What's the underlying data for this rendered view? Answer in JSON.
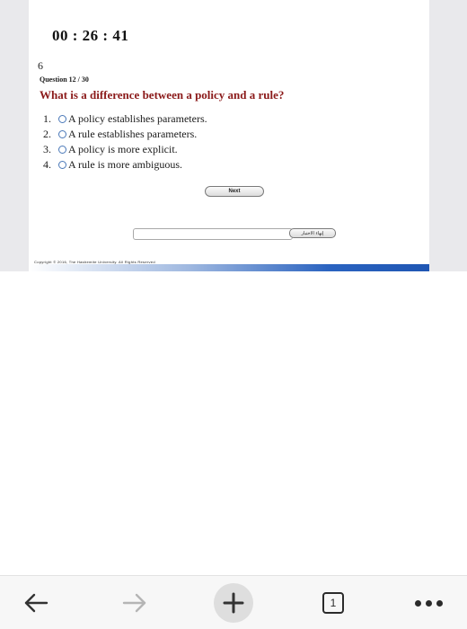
{
  "quiz": {
    "timer": "00 : 26 : 41",
    "question_number": "6",
    "question_counter": "Question 12 / 30",
    "question_text": "What is a difference between a policy and a rule?",
    "options": [
      {
        "num": "1.",
        "label": "A policy establishes parameters."
      },
      {
        "num": "2.",
        "label": "A rule establishes parameters."
      },
      {
        "num": "3.",
        "label": "A policy is more explicit."
      },
      {
        "num": "4.",
        "label": "A rule is more ambiguous."
      }
    ],
    "next_label": "Next",
    "input_value": "",
    "submit_label": "إنهاء الاختبار",
    "copyright": "Copyright © 2016, The Hashemite University. All Rights Reserved",
    "footer_colors": [
      "#9fb8e0",
      "#2a63c0",
      "#1f56b3"
    ]
  },
  "browser": {
    "tab_count": "1",
    "icons": [
      "back-arrow-icon",
      "forward-arrow-icon",
      "plus-icon",
      "tabs-icon",
      "more-dots-icon"
    ]
  }
}
